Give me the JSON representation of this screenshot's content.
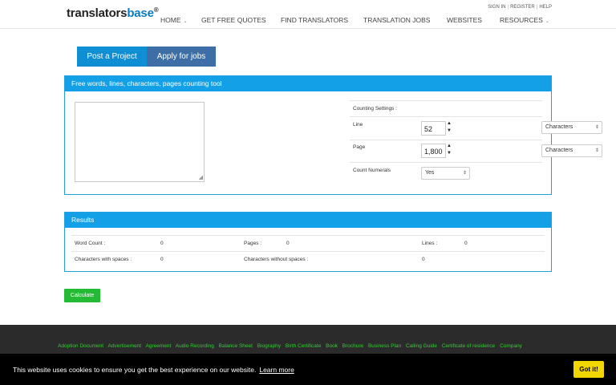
{
  "header": {
    "logo": {
      "part1": "translators",
      "part2": "base",
      "mark": "®"
    },
    "toplinks": [
      "SIGN IN",
      "REGISTER",
      "HELP"
    ],
    "nav": [
      "HOME",
      "GET FREE QUOTES",
      "FIND TRANSLATORS",
      "TRANSLATION JOBS",
      "WEBSITES",
      "RESOURCES"
    ]
  },
  "tabs": {
    "post": "Post a Project",
    "apply": "Apply for jobs"
  },
  "tool": {
    "title": "Free words, lines, characters, pages counting tool",
    "textarea_value": "",
    "settings_title": "Counting Settings :",
    "line_label": "Line",
    "line_value": "52",
    "line_unit": "Characters",
    "page_label": "Page",
    "page_value": "1,800",
    "page_unit": "Characters",
    "numerals_label": "Count Numerals",
    "numerals_value": "Yes"
  },
  "results": {
    "title": "Results",
    "word_count_label": "Word Count :",
    "word_count": "0",
    "pages_label": "Pages :",
    "pages": "0",
    "lines_label": "Lines :",
    "lines": "0",
    "chars_spaces_label": "Characters with spaces :",
    "chars_spaces": "0",
    "chars_nospaces_label": "Characters without spaces :",
    "chars_nospaces": "0"
  },
  "calculate_label": "Calculate",
  "footer": {
    "links": [
      "Adoption Document",
      "Advertisement",
      "Agreement",
      "Audio Recording",
      "Balance Sheet",
      "Biography",
      "Birth Certificate",
      "Book",
      "Brochure",
      "Business Plan",
      "Calling Guide",
      "Certificate of residence",
      "Company"
    ]
  },
  "cookie": {
    "text": "This website uses cookies to ensure you get the best experience on our website.",
    "link": "Learn more",
    "button": "Got it!"
  },
  "colors": {
    "accent": "#14a0e6",
    "tab_post": "#0f8ed4",
    "tab_apply": "#3d6fa6",
    "calculate": "#22bb33",
    "cookie_button": "#f1d600",
    "footer_links": "#33cc33"
  }
}
